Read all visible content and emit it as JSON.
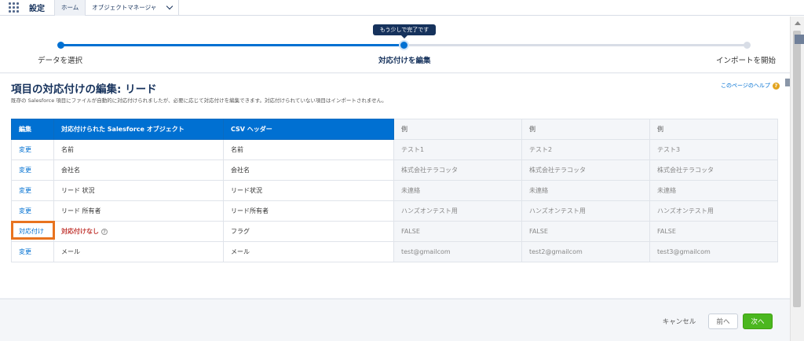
{
  "nav": {
    "app_name": "設定",
    "tabs": [
      "ホーム",
      "オブジェクトマネージャ"
    ]
  },
  "wizard": {
    "badge": "もう少しで完了です",
    "steps": [
      "データを選択",
      "対応付けを編集",
      "インポートを開始"
    ],
    "current_step": 2
  },
  "page": {
    "title": "項目の対応付けの編集: リード",
    "subtitle": "既存の Salesforce 項目にファイルが自動的に対応付けられましたが、必要に応じて対応付けを編集できます。対応付けられていない項目はインポートされません。",
    "help": "このページのヘルプ"
  },
  "table": {
    "headers": [
      "編集",
      "対応付けられた Salesforce オブジェクト",
      "CSV ヘッダー",
      "例",
      "例",
      "例"
    ],
    "rows": [
      {
        "action": "変更",
        "field": "名前",
        "csv": "名前",
        "ex1": "テスト1",
        "ex2": "テスト2",
        "ex3": "テスト3"
      },
      {
        "action": "変更",
        "field": "会社名",
        "csv": "会社名",
        "ex1": "株式会社テラコッタ",
        "ex2": "株式会社テラコッタ",
        "ex3": "株式会社テラコッタ"
      },
      {
        "action": "変更",
        "field": "リード 状況",
        "csv": "リード状況",
        "ex1": "未連絡",
        "ex2": "未連絡",
        "ex3": "未連絡"
      },
      {
        "action": "変更",
        "field": "リード 所有者",
        "csv": "リード所有者",
        "ex1": "ハンズオンテスト用",
        "ex2": "ハンズオンテスト用",
        "ex3": "ハンズオンテスト用"
      },
      {
        "action": "対応付け",
        "field": "対応付けなし",
        "csv": "フラグ",
        "ex1": "FALSE",
        "ex2": "FALSE",
        "ex3": "FALSE"
      },
      {
        "action": "変更",
        "field": "メール",
        "csv": "メール",
        "ex1": "test@gmailcom",
        "ex2": "test2@gmailcom",
        "ex3": "test3@gmailcom"
      }
    ]
  },
  "footer": {
    "cancel": "キャンセル",
    "prev": "前へ",
    "next": "次へ"
  },
  "colors": {
    "brand_blue": "#0070d2",
    "next_green": "#4bb71f",
    "highlight_orange": "#e8731f",
    "unmapped_red": "#c23934"
  }
}
